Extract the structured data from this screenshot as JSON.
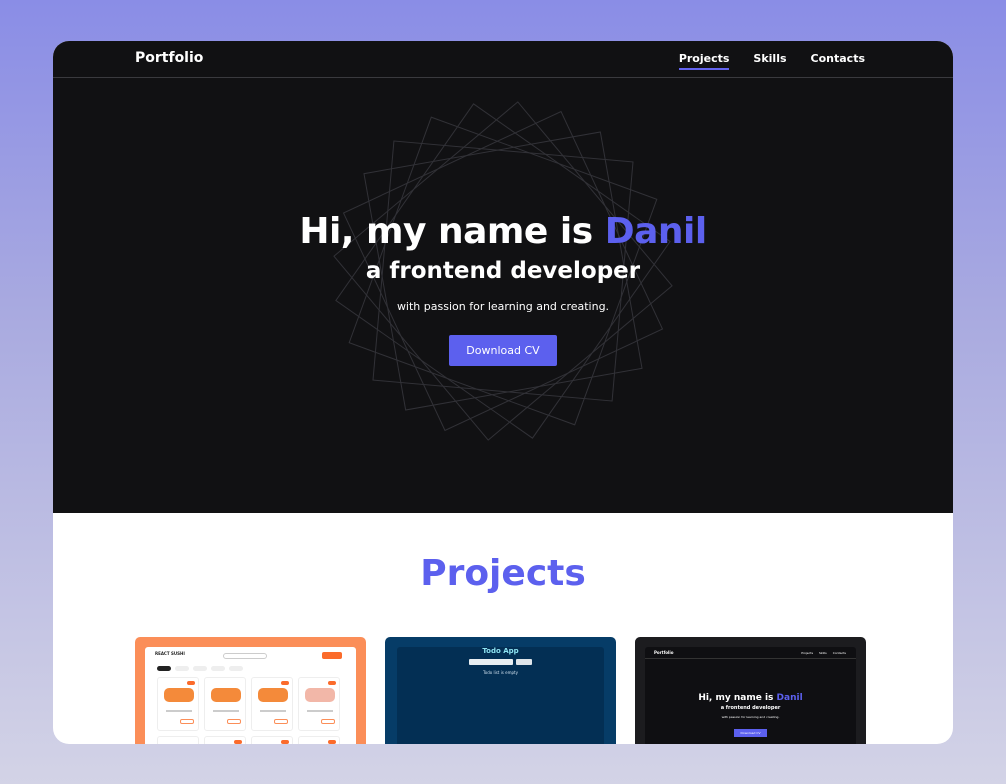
{
  "nav": {
    "logo": "Portfolio",
    "links": [
      "Projects",
      "Skills",
      "Contacts"
    ]
  },
  "hero": {
    "title_prefix": "Hi, my name is",
    "name": "Danil",
    "subtitle": "a frontend developer",
    "tagline": "with passion for learning and creating.",
    "cta": "Download CV"
  },
  "projects": {
    "heading": "Projects",
    "cards": [
      {
        "title": "REACT SUSHI",
        "labels": [
          "Филадельфия",
          "Калифорния",
          "Копченый лосось",
          "Унаги маки"
        ],
        "prices": [
          "290 ₽",
          "250 ₽",
          "260 ₽",
          "280 ₽"
        ]
      },
      {
        "title": "Todo App",
        "empty_text": "Todo list is empty",
        "button": "Submit"
      },
      {
        "logo": "Portfolio",
        "nav": [
          "Projects",
          "Skills",
          "Contacts"
        ],
        "title_prefix": "Hi, my name is",
        "name": "Danil",
        "subtitle": "a frontend developer",
        "tagline": "with passion for learning and creating.",
        "cta": "Download CV"
      }
    ]
  },
  "colors": {
    "accent": "#5c60ee",
    "hero_bg": "#111113",
    "card_orange": "#fb8e58",
    "card_navy": "#063c67",
    "card_dark": "#1c1c1f"
  }
}
